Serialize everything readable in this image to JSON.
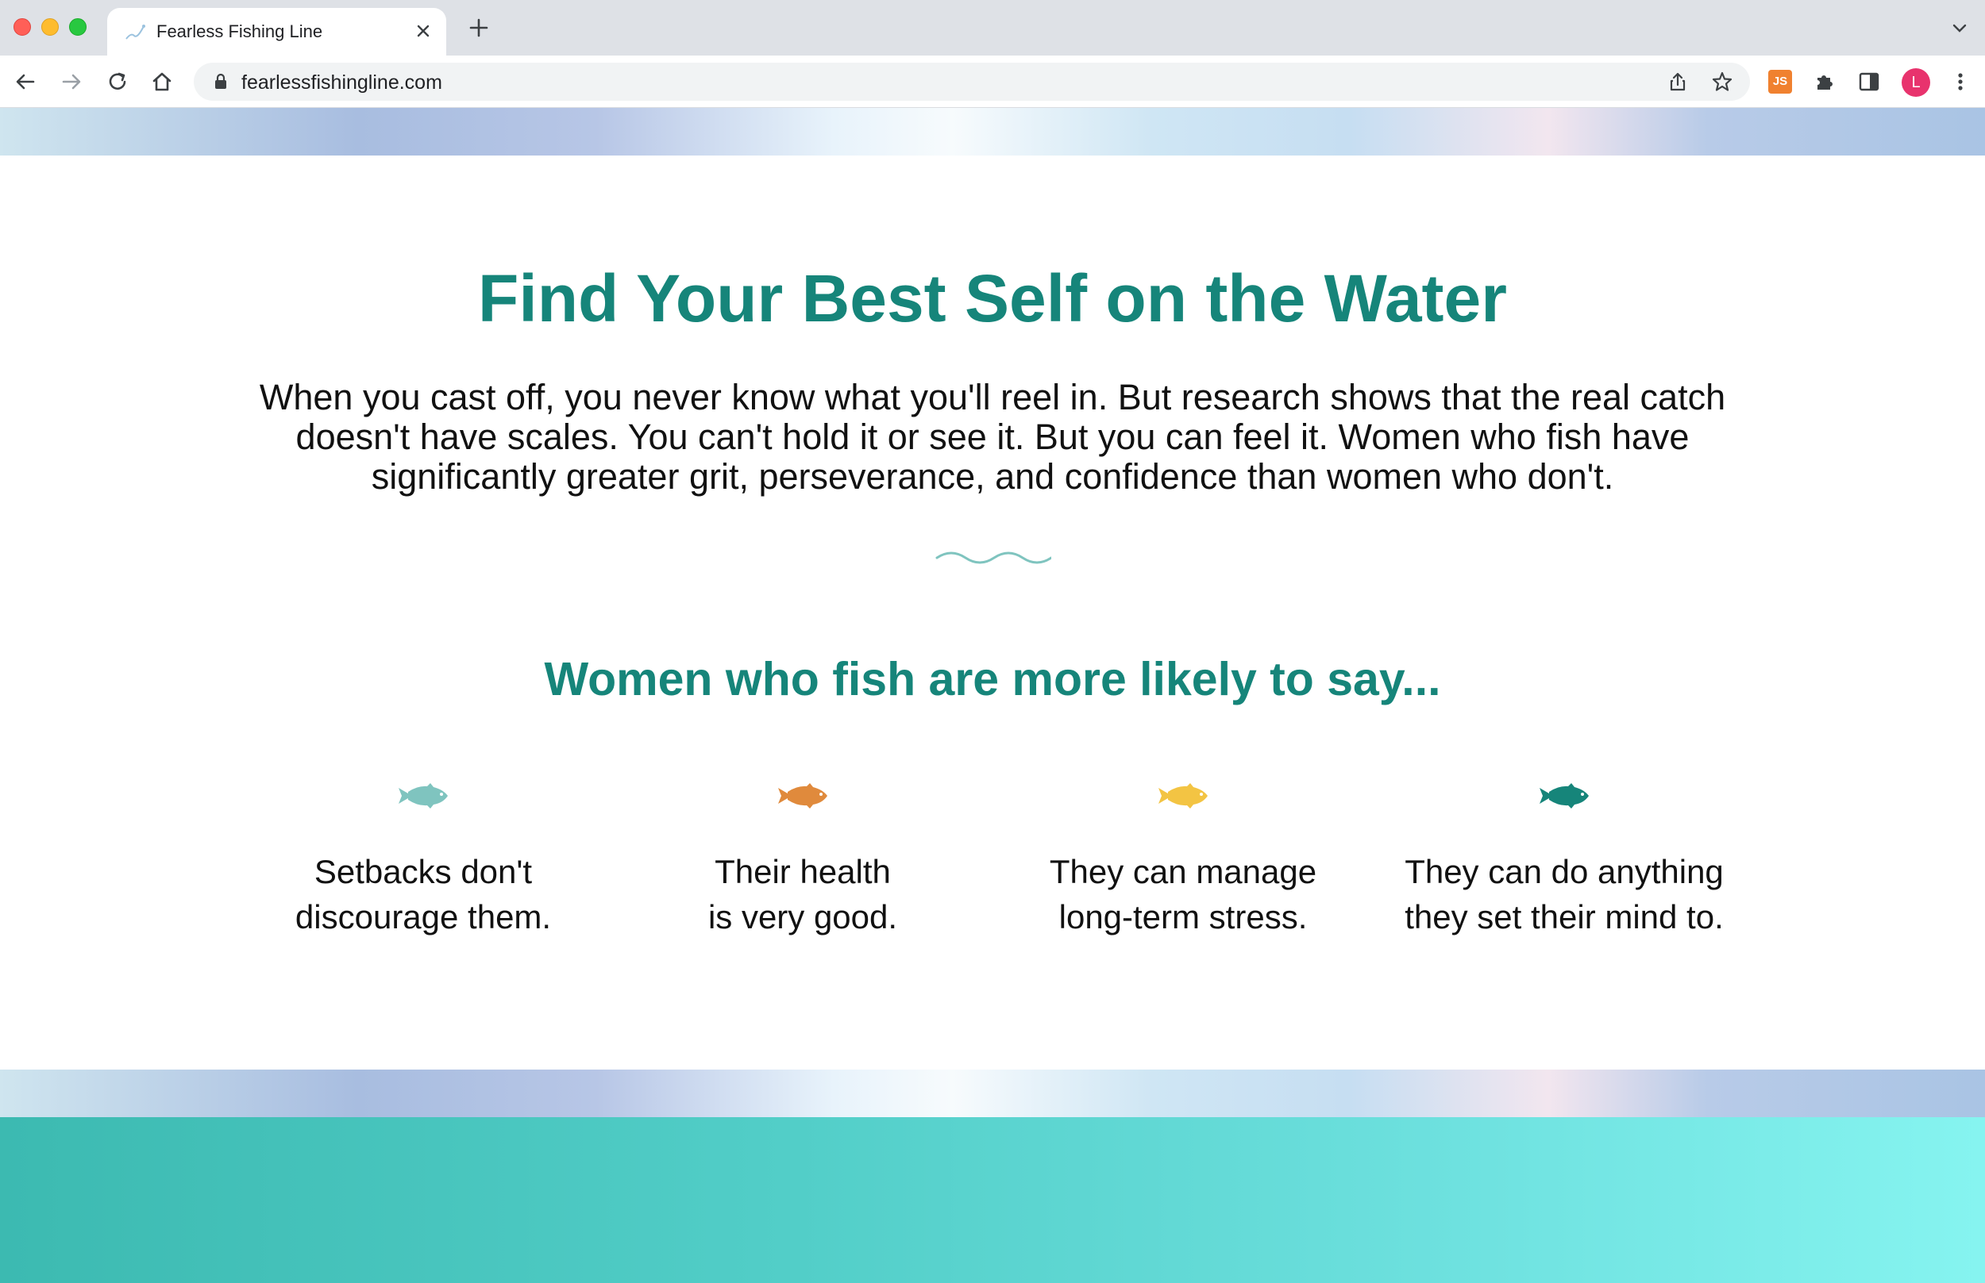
{
  "browser": {
    "tab_title": "Fearless Fishing Line",
    "url": "fearlessfishingline.com",
    "extension_label": "JS",
    "avatar_initial": "L"
  },
  "hero": {
    "title": "Find Your Best Self on the Water",
    "body": "When you cast off, you never know what you'll reel in. But research shows that the real catch doesn't have scales. You can't hold it or see it. But you can feel it. Women who fish have significantly greater grit, perseverance, and confidence than women who don't."
  },
  "section": {
    "title": "Women who fish are more likely to say..."
  },
  "stats": [
    {
      "line1": "Setbacks don't",
      "line2": "discourage them.",
      "fish_color": "#7fc4bf"
    },
    {
      "line1": "Their health",
      "line2": "is very good.",
      "fish_color": "#e08a3c"
    },
    {
      "line1": "They can manage",
      "line2": "long-term stress.",
      "fish_color": "#f3c443"
    },
    {
      "line1": "They can do anything",
      "line2": "they set their mind to.",
      "fish_color": "#16857a"
    }
  ],
  "colors": {
    "brand_teal": "#16857a",
    "wave": "#7fc4bf"
  }
}
